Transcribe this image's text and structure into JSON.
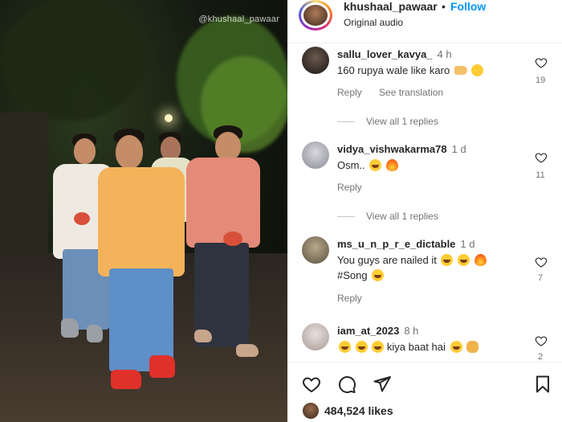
{
  "media": {
    "watermark": "@khushaal_pawaar"
  },
  "header": {
    "username": "khushaal_pawaar",
    "separator": "•",
    "follow_label": "Follow",
    "audio": "Original audio"
  },
  "comments": [
    {
      "username": "sallu_lover_kavya_",
      "time": "4 h",
      "text": "160 rupya wale like karo",
      "emojis": [
        "point-left",
        "smirk"
      ],
      "reply_label": "Reply",
      "translation_label": "See translation",
      "likes": "19",
      "view_replies": "View all 1 replies"
    },
    {
      "username": "vidya_vishwakarma78",
      "time": "1 d",
      "text": "Osm..",
      "emojis": [
        "laugh",
        "fire"
      ],
      "reply_label": "Reply",
      "likes": "11",
      "view_replies": "View all 1 replies"
    },
    {
      "username": "ms_u_n_p_r_e_dictable",
      "time": "1 d",
      "text": "You guys are nailed it",
      "emojis": [
        "laugh",
        "laugh",
        "fire"
      ],
      "text2": "#Song",
      "emojis2": [
        "laugh"
      ],
      "reply_label": "Reply",
      "likes": "7"
    },
    {
      "username": "iam_at_2023",
      "time": "8 h",
      "emojis_lead": [
        "laugh",
        "laugh",
        "laugh"
      ],
      "text": "kiya baat hai",
      "emojis": [
        "laugh",
        "clap"
      ],
      "likes": "2"
    }
  ],
  "actions": {
    "icons": [
      "heart-icon",
      "comment-icon",
      "share-icon",
      "bookmark-icon"
    ]
  },
  "likes_count": "484,524 likes"
}
